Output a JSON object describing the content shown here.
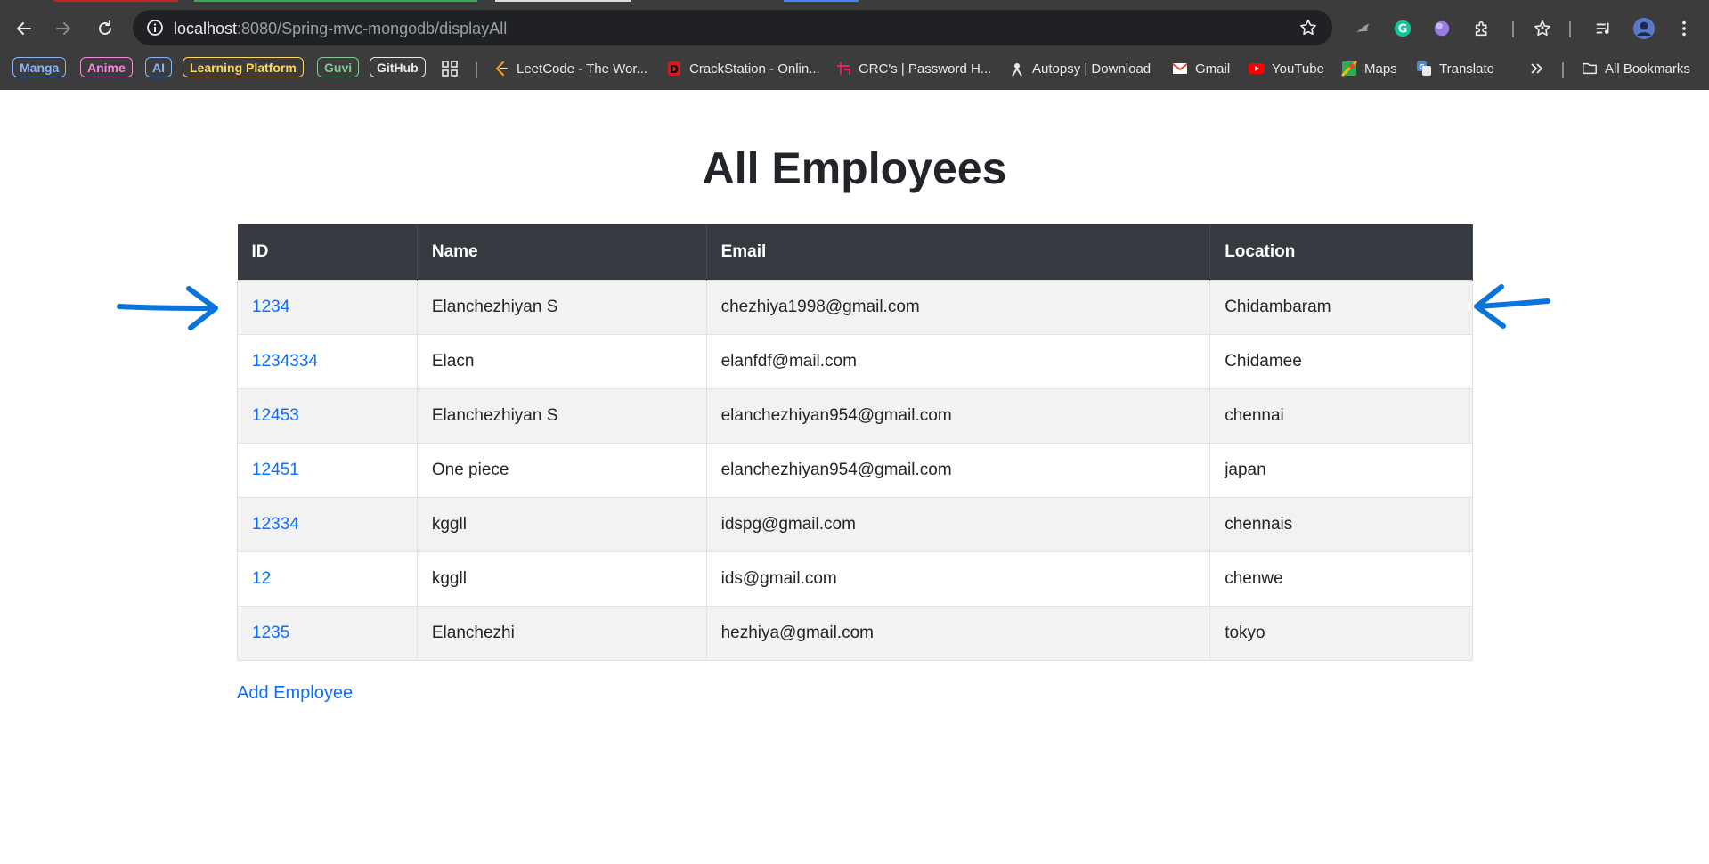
{
  "browser": {
    "url_host": "localhost",
    "url_path": ":8080/Spring-mvc-mongodb/displayAll",
    "bookmark_chips": [
      {
        "label": "Manga",
        "color": "#8ab4f8"
      },
      {
        "label": "Anime",
        "color": "#f28bdc"
      },
      {
        "label": "AI",
        "color": "#8ab4f8"
      },
      {
        "label": "Learning Platform",
        "color": "#fdd663"
      },
      {
        "label": "Guvi",
        "color": "#81c995"
      },
      {
        "label": "GitHub",
        "color": "#e8eaed"
      }
    ],
    "bookmarks": [
      {
        "label": "LeetCode - The Wor...",
        "icon": "leetcode-icon"
      },
      {
        "label": "CrackStation - Onlin...",
        "icon": "crackstation-icon"
      },
      {
        "label": "GRC's | Password H...",
        "icon": "grc-icon"
      },
      {
        "label": "Autopsy | Download",
        "icon": "autopsy-icon"
      },
      {
        "label": "Gmail",
        "icon": "gmail-icon"
      },
      {
        "label": "YouTube",
        "icon": "youtube-icon"
      },
      {
        "label": "Maps",
        "icon": "maps-icon"
      },
      {
        "label": "Translate",
        "icon": "translate-icon"
      }
    ],
    "all_bookmarks_label": "All Bookmarks"
  },
  "page": {
    "title": "All Employees",
    "add_link": "Add Employee",
    "link_color": "#0d6efd",
    "annotation_color": "#0a74da"
  },
  "table": {
    "headers": [
      "ID",
      "Name",
      "Email",
      "Location"
    ],
    "rows": [
      [
        "1234",
        "Elanchezhiyan S",
        "chezhiya1998@gmail.com",
        "Chidambaram"
      ],
      [
        "1234334",
        "Elacn",
        "elanfdf@mail.com",
        "Chidamee"
      ],
      [
        "12453",
        "Elanchezhiyan S",
        "elanchezhiyan954@gmail.com",
        "chennai"
      ],
      [
        "12451",
        "One piece",
        "elanchezhiyan954@gmail.com",
        "japan"
      ],
      [
        "12334",
        "kggll",
        "idspg@gmail.com",
        "chennais"
      ],
      [
        "12",
        "kggll",
        "ids@gmail.com",
        "chenwe"
      ],
      [
        "1235",
        "Elanchezhi",
        "hezhiya@gmail.com",
        "tokyo"
      ]
    ]
  }
}
